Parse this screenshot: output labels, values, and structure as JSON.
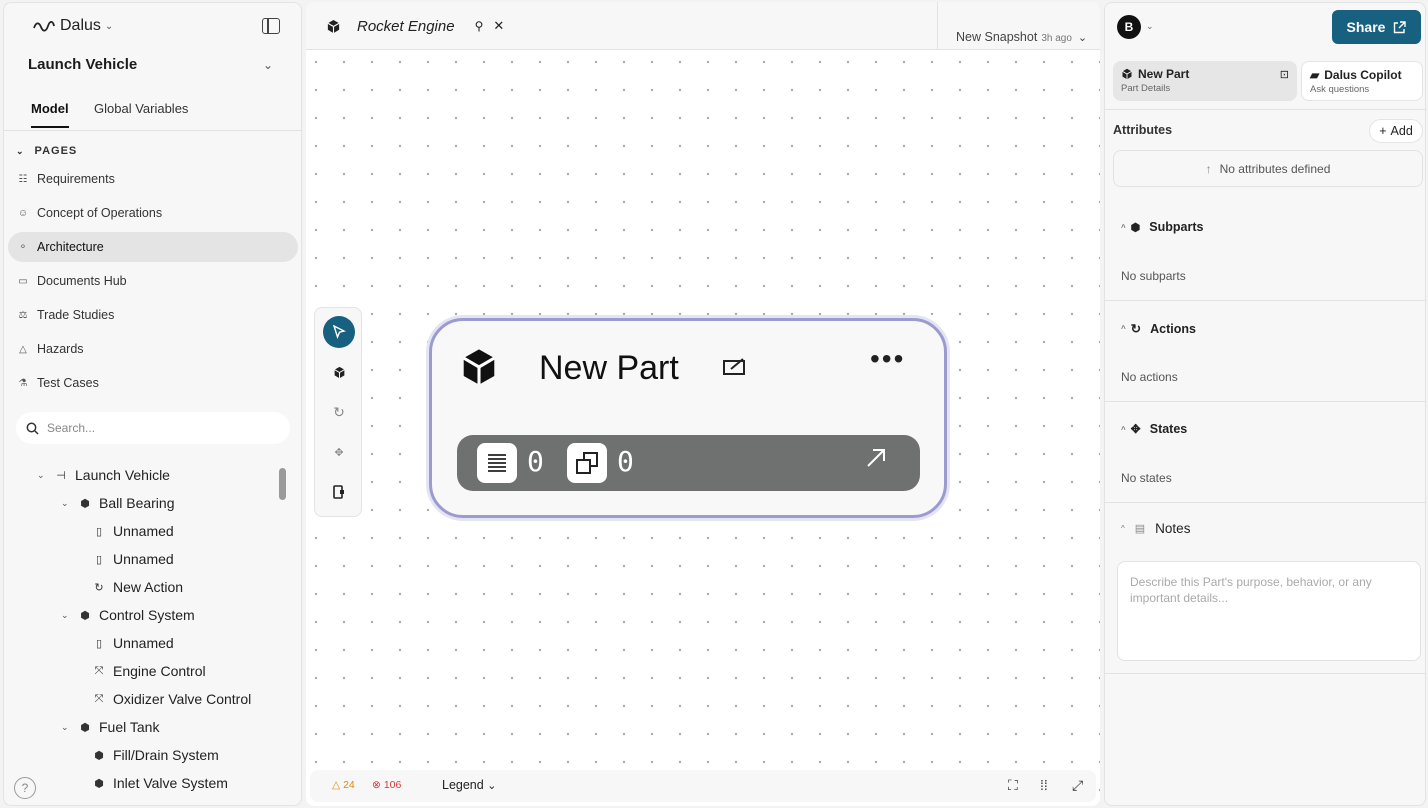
{
  "app": {
    "name": "Dalus"
  },
  "sidebar": {
    "project": "Launch Vehicle",
    "tabs": [
      "Model",
      "Global Variables"
    ],
    "section": "PAGES",
    "pages": [
      {
        "label": "Requirements",
        "icon": "list-icon"
      },
      {
        "label": "Concept of Operations",
        "icon": "users-icon"
      },
      {
        "label": "Architecture",
        "icon": "graph-icon",
        "active": true
      },
      {
        "label": "Documents Hub",
        "icon": "folder-icon"
      },
      {
        "label": "Trade Studies",
        "icon": "scale-icon"
      },
      {
        "label": "Hazards",
        "icon": "warning-icon"
      },
      {
        "label": "Test Cases",
        "icon": "flask-icon"
      }
    ],
    "search_placeholder": "Search...",
    "tree": [
      {
        "label": "Launch Vehicle",
        "icon": "hierarchy-icon",
        "level": 0
      },
      {
        "label": "Ball Bearing",
        "icon": "cube-icon",
        "level": 1
      },
      {
        "label": "Unnamed",
        "icon": "port-icon",
        "level": 2
      },
      {
        "label": "Unnamed",
        "icon": "port-icon",
        "level": 2
      },
      {
        "label": "New Action",
        "icon": "refresh-icon",
        "level": 2
      },
      {
        "label": "Control System",
        "icon": "cube-icon",
        "level": 1
      },
      {
        "label": "Unnamed",
        "icon": "port-icon",
        "level": 2
      },
      {
        "label": "Engine Control",
        "icon": "interface-icon",
        "level": 2
      },
      {
        "label": "Oxidizer Valve Control",
        "icon": "interface-icon",
        "level": 2
      },
      {
        "label": "Fuel Tank",
        "icon": "cube-icon",
        "level": 1
      },
      {
        "label": "Fill/Drain System",
        "icon": "cube-icon",
        "level": 2
      },
      {
        "label": "Inlet Valve System",
        "icon": "cube-icon",
        "level": 2
      }
    ],
    "help": "?"
  },
  "canvas": {
    "doc_tab": "Rocket Engine",
    "snapshot": "New Snapshot",
    "snapshot_ago": "3h ago",
    "part": {
      "title": "New Part",
      "attr_count": "0",
      "subpart_count": "0",
      "more": "•••"
    },
    "bottom": {
      "warnings": "24",
      "errors": "106",
      "legend": "Legend"
    }
  },
  "rpanel": {
    "avatar": "B",
    "share": "Share",
    "tabs": [
      {
        "title": "New Part",
        "sub": "Part Details"
      },
      {
        "title": "Dalus Copilot",
        "sub": "Ask questions"
      }
    ],
    "attributes": {
      "title": "Attributes",
      "add": "Add",
      "empty": "No attributes defined"
    },
    "subparts": {
      "title": "Subparts",
      "empty": "No subparts"
    },
    "actions": {
      "title": "Actions",
      "empty": "No actions"
    },
    "states": {
      "title": "States",
      "empty": "No states"
    },
    "notes": {
      "title": "Notes",
      "placeholder": "Describe this Part's purpose, behavior, or any important details..."
    }
  },
  "colors": {
    "accent": "#17607f",
    "card_border": "#9c9bd0",
    "warning": "#d88b10",
    "error": "#d23b3b"
  }
}
